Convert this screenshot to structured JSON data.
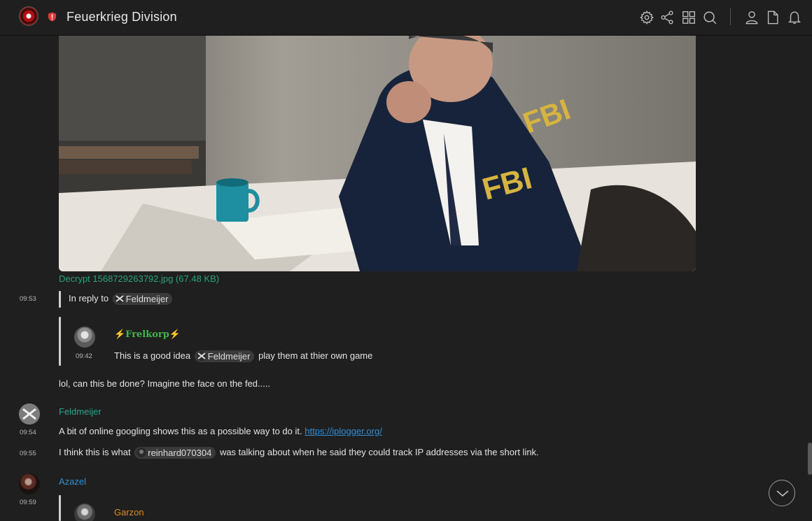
{
  "header": {
    "room_name": "Feuerkrieg Division",
    "icons": [
      "settings-icon",
      "share-icon",
      "apps-grid-icon",
      "search-icon",
      "user-icon",
      "file-icon",
      "bell-icon"
    ]
  },
  "image_message": {
    "file_label": "Decrypt 1568729263792.jpg (67.48 KB)"
  },
  "reply_0953": {
    "time": "09:53",
    "prefix": "In reply to",
    "pill": "Feldmeijer",
    "quoted": {
      "author": "⚡Frelkorp⚡",
      "time": "09:42",
      "text_before": "This is a good idea",
      "pill": "Feldmeijer",
      "text_after": "play them at thier own game"
    },
    "body": "lol, can this be done? Imagine the face on the fed....."
  },
  "feldmeijer_block": {
    "author": "Feldmeijer",
    "messages": [
      {
        "time": "09:54",
        "text": "A bit of online googling shows this as a possible way to do it.",
        "link": "https://iplogger.org/"
      },
      {
        "time": "09:55",
        "text_before": "I think this is what",
        "pill": "reinhard070304",
        "text_after": "was talking about when he said they could track IP addresses via the short link."
      }
    ]
  },
  "azazel_block": {
    "author": "Azazel",
    "time": "09:59",
    "quoted_author": "Garzon"
  },
  "colors": {
    "background": "#1f1f1f",
    "link": "#2aa37a",
    "feldmeijer_name": "#2ba58a",
    "azazel_name": "#2f8fd9",
    "garzon_name": "#e08a1e",
    "frelkorp_name": "#3fb74a"
  }
}
